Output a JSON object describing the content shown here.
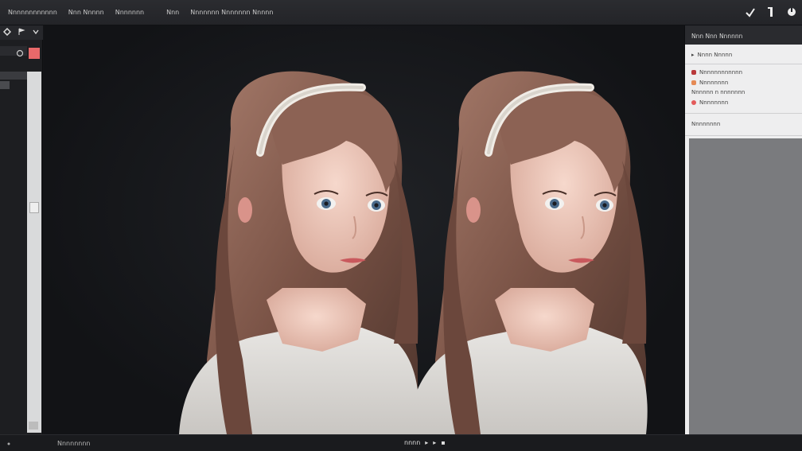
{
  "menubar": {
    "items": [
      "Nnnnnnnnnnnn",
      "Nnn Nnnnn",
      "Nnnnnnn",
      "Nnn",
      "Nnnnnnn Nnnnnnn Nnnnn"
    ]
  },
  "toolbar_right": {
    "icons": [
      "check-icon",
      "bar-icon",
      "toggle-icon"
    ]
  },
  "left_panel": {
    "tool_icons": [
      "move-icon",
      "flag-icon",
      "chevron-down-icon"
    ],
    "swatch_color": "#e8696a"
  },
  "right_panel": {
    "header": "Nnn Nnn Nnnnnn",
    "section_title": "Nnnn Nnnnn",
    "rows": [
      {
        "label": "Nnnnnnnnnnnn",
        "color": "#b9393b"
      },
      {
        "label": "Nnnnnnnn",
        "color": "#e58a55"
      },
      {
        "label": "Nnnnnn    n    nnnnnnn",
        "color": ""
      },
      {
        "label": "Nnnnnnnn",
        "color": "#e35b5b"
      }
    ],
    "section2_title": "Nnnnnnnn"
  },
  "canvas": {
    "figure_count": 2
  },
  "status_bar": {
    "label": "Nnnnnnnn",
    "controls": [
      "nnnn",
      "▸",
      "▸",
      "▪"
    ]
  }
}
